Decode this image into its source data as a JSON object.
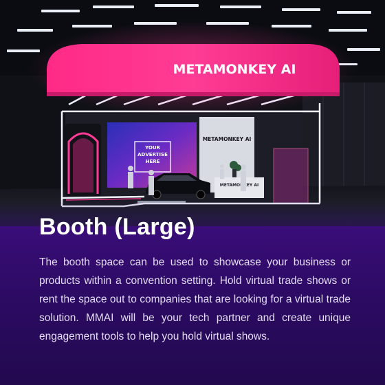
{
  "booth": {
    "sign_text": "METAMONKEY AI",
    "screen_lines": [
      "YOUR",
      "ADVERTISE",
      "HERE"
    ],
    "back_wall_logo": "METAMONKEY AI",
    "desk_logo": "METAMONKEY AI",
    "accent_color": "#ff2f8e",
    "panel_color": "#2e0b66"
  },
  "card": {
    "title": "Booth (Large)",
    "description": "The booth space can be used to showcase your business or products within a convention setting. Hold virtual trade shows or rent the space out to companies that are looking for a virtual trade solution. MMAI will be your tech partner and create unique engagement tools to help you hold virtual shows."
  }
}
